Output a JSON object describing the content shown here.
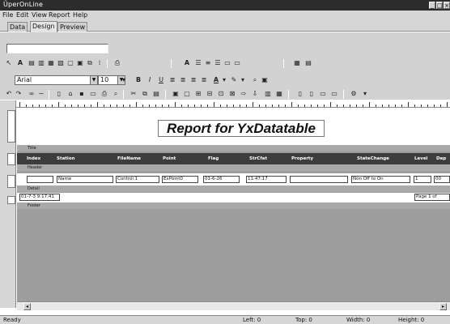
{
  "app": {
    "title": "ÜperOnLine"
  },
  "menu": [
    "File",
    "Edit",
    "View",
    "Report",
    "Help"
  ],
  "tabs": [
    "Data",
    "Design",
    "Preview"
  ],
  "toolbar": {
    "font_name": "Arial",
    "font_size": "10",
    "bold": "B",
    "italic": "I",
    "underline": "U",
    "text_tool": "A",
    "font_color": "A"
  },
  "report": {
    "title": "Report for YxDatatable",
    "bands": {
      "title": "Title",
      "header": "Header",
      "detail": "Detail",
      "footer": "Footer"
    },
    "columns": [
      "Index",
      "Station",
      "FileName",
      "Point",
      "Flag",
      "StrCfat",
      "Property",
      "StateChange",
      "Level",
      "Dep"
    ],
    "detail_cells": [
      "",
      "Name",
      "Control 1",
      "ExPoint0",
      "01-6-26",
      "11:47:17",
      "",
      "Non Off to On",
      "1",
      "00"
    ],
    "footer_left": "01-7-3 9:17:41",
    "footer_right": "Page 1 of"
  },
  "status": {
    "left": "Ready",
    "s1": "Left: 0",
    "s2": "Top: 0",
    "s3": "Width: 0",
    "s4": "Height: 0"
  }
}
